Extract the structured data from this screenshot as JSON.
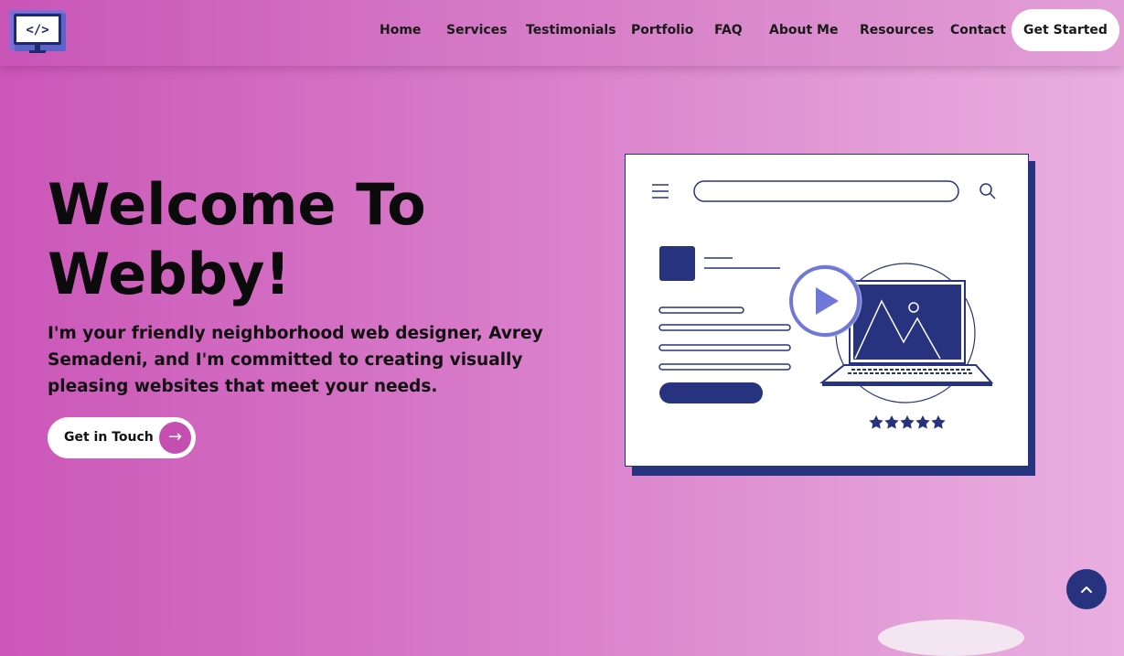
{
  "nav": {
    "logo_code": "</>",
    "items": [
      "Home",
      "Services",
      "Testimonials",
      "Portfolio",
      "FAQ",
      "About Me",
      "Resources",
      "Contact"
    ],
    "cta": "Get Started"
  },
  "hero": {
    "title_line1": "Welcome To",
    "title_line2": "Webby!",
    "text": "I'm your friendly neighborhood web designer, Avrey Semadeni, and I'm committed to creating visually pleasing websites that meet your needs.",
    "button": "Get in Touch"
  },
  "illustration": {
    "rating_stars": 5
  },
  "colors": {
    "navy": "#283380",
    "accent_pink": "#c44fb1",
    "play_ring": "#6f78d6"
  }
}
